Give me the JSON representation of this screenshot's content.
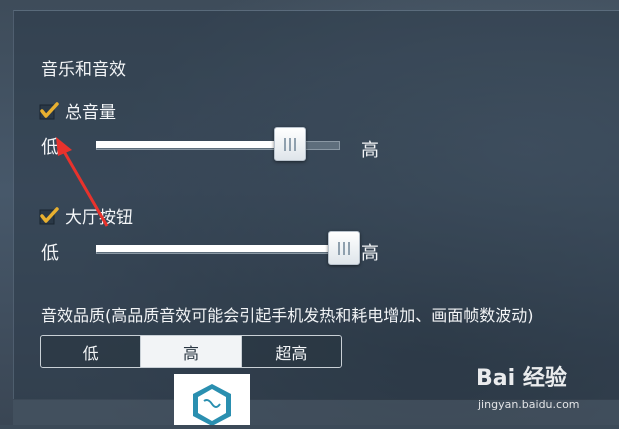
{
  "settings": {
    "section_title": "音乐和音效",
    "master_volume": {
      "label": "总音量",
      "checked": true,
      "level": 0.79,
      "low": "低",
      "high": "高"
    },
    "lobby_music": {
      "label": "大厅按钮",
      "checked": true,
      "level": 0.95,
      "low": "低",
      "high": "高"
    },
    "quality": {
      "title": "音效品质(高品质音效可能会引起手机发热和耗电增加、画面帧数波动)",
      "options": [
        "低",
        "高",
        "超高"
      ],
      "selected": "高"
    }
  },
  "colors": {
    "check": "#e8b030",
    "accent_arrow": "#e8322c"
  },
  "watermark": {
    "logo": "Bai 经验",
    "url": "jingyan.baidu.com"
  }
}
